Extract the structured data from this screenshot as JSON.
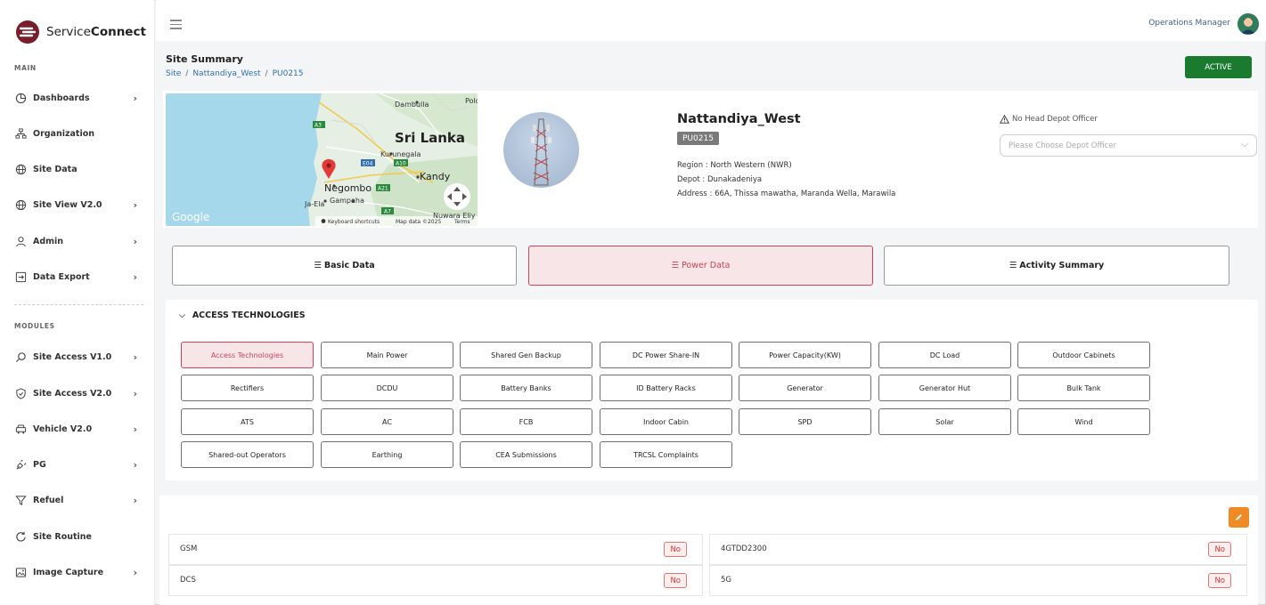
{
  "app": {
    "brand_light": "Service",
    "brand_bold": "Connect",
    "accent_color": "#7a1c2a",
    "user_role": "Operations Manager"
  },
  "sidebar": {
    "main_label": "MAIN",
    "modules_label": "MODULES",
    "main_items": [
      {
        "label": "Dashboards",
        "icon": "chart-pie-icon",
        "has_submenu": true
      },
      {
        "label": "Organization",
        "icon": "org-chart-icon",
        "has_submenu": false
      },
      {
        "label": "Site Data",
        "icon": "globe-icon",
        "has_submenu": false
      },
      {
        "label": "Site View V2.0",
        "icon": "globe-icon",
        "has_submenu": true
      },
      {
        "label": "Admin",
        "icon": "user-icon",
        "has_submenu": true
      },
      {
        "label": "Data Export",
        "icon": "export-icon",
        "has_submenu": true
      }
    ],
    "module_items": [
      {
        "label": "Site Access V1.0",
        "icon": "search-icon",
        "has_submenu": true
      },
      {
        "label": "Site Access V2.0",
        "icon": "shield-check-icon",
        "has_submenu": true
      },
      {
        "label": "Vehicle V2.0",
        "icon": "car-icon",
        "has_submenu": true
      },
      {
        "label": "PG",
        "icon": "plug-icon",
        "has_submenu": true
      },
      {
        "label": "Refuel",
        "icon": "funnel-icon",
        "has_submenu": true
      },
      {
        "label": "Site Routine",
        "icon": "refresh-icon",
        "has_submenu": false
      },
      {
        "label": "Image Capture",
        "icon": "image-icon",
        "has_submenu": true
      }
    ]
  },
  "header": {
    "title": "Site Summary",
    "breadcrumb": [
      "Site",
      "Nattandiya_West",
      "PU0215"
    ],
    "status_button": "ACTIVE",
    "status_color": "#1a7a2e"
  },
  "map": {
    "labels": {
      "country": "Sri Lanka",
      "city1": "Negombo",
      "city2": "Kandy",
      "city3": "Kurunegala",
      "city4": "Dambulla",
      "city5": "Gampaha",
      "city6": "Ja-Ela",
      "city7": "Nuwara Eliy",
      "city8": "Polo",
      "road1": "A3",
      "road2": "E04",
      "road3": "A10",
      "road4": "A21",
      "road5": "A7",
      "google": "Google",
      "footer1": "Keyboard shortcuts",
      "footer2": "Map data ©2025",
      "footer3": "Terms"
    }
  },
  "site": {
    "name": "Nattandiya_West",
    "code": "PU0215",
    "region": "Region : North Western (NWR)",
    "depot": "Depot : Dunakadeniya",
    "address": "Address : 66A, Thissa mawatha, Maranda Wella, Marawila",
    "officer_warning": "No Head Depot Officer",
    "officer_placeholder": "Please Choose Depot Officer"
  },
  "main_tabs": [
    {
      "label": "Basic Data",
      "active": false
    },
    {
      "label": "Power Data",
      "active": true
    },
    {
      "label": "Activity Summary",
      "active": false
    }
  ],
  "tech_section": {
    "heading": "ACCESS TECHNOLOGIES",
    "chips": [
      "Access Technologies",
      "Main Power",
      "Shared Gen Backup",
      "DC Power Share-IN",
      "Power Capacity(KW)",
      "DC Load",
      "Outdoor Cabinets",
      "Rectifiers",
      "DCDU",
      "Battery Banks",
      "ID Battery Racks",
      "Generator",
      "Generator Hut",
      "Bulk Tank",
      "ATS",
      "AC",
      "FCB",
      "Indoor Cabin",
      "SPD",
      "Solar",
      "Wind",
      "Shared-out Operators",
      "Earthing",
      "CEA Submissions",
      "TRCSL Complaints"
    ],
    "active_chip": "Access Technologies"
  },
  "tech_table": [
    {
      "label": "GSM",
      "value": "No"
    },
    {
      "label": "4GTDD2300",
      "value": "No"
    },
    {
      "label": "DCS",
      "value": "No"
    },
    {
      "label": "5G",
      "value": "No"
    }
  ]
}
